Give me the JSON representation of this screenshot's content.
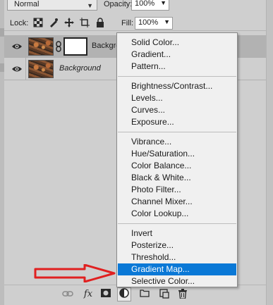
{
  "layers_panel": {
    "blend_mode": "Normal",
    "opacity_label": "Opacity:",
    "opacity_value": "100%",
    "lock_label": "Lock:",
    "fill_label": "Fill:",
    "fill_value": "100%",
    "layers": [
      {
        "name": "Backgro",
        "selected": true,
        "visible": true,
        "has_mask": true
      },
      {
        "name": "Background",
        "selected": false,
        "visible": true,
        "has_mask": false
      }
    ],
    "bottom_icons": [
      "link-layers-icon",
      "fx-icon",
      "add-mask-icon",
      "adjustment-layer-icon",
      "new-group-icon",
      "new-layer-icon",
      "trash-icon"
    ],
    "fx_label": "fx"
  },
  "adjustment_menu": {
    "groups": [
      [
        "Solid Color...",
        "Gradient...",
        "Pattern..."
      ],
      [
        "Brightness/Contrast...",
        "Levels...",
        "Curves...",
        "Exposure..."
      ],
      [
        "Vibrance...",
        "Hue/Saturation...",
        "Color Balance...",
        "Black & White...",
        "Photo Filter...",
        "Channel Mixer...",
        "Color Lookup..."
      ],
      [
        "Invert",
        "Posterize...",
        "Threshold...",
        "Gradient Map...",
        "Selective Color..."
      ]
    ],
    "highlighted": "Gradient Map..."
  },
  "colors": {
    "panel_bg": "#cfcfcf",
    "menu_bg": "#f0f0f0",
    "highlight": "#0a78d6",
    "arrow": "#e02020"
  }
}
